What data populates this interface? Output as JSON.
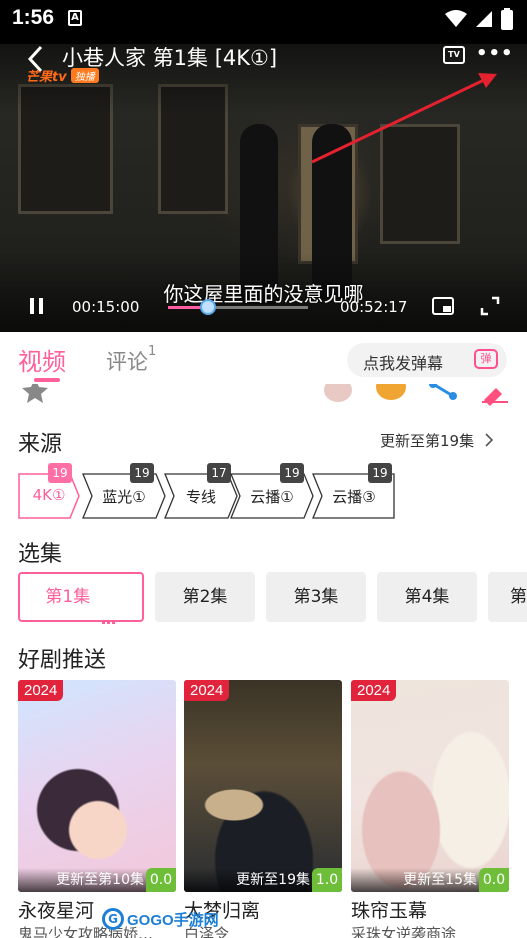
{
  "status_bar": {
    "time": "1:56",
    "notification_icon": "A"
  },
  "player": {
    "title": "小巷人家 第1集 [4K①]",
    "logo_text": "芒果tv",
    "logo_badge": "独播",
    "tv_label": "TV",
    "subtitle": "你这屋里面的没意见哪",
    "current_time": "00:15:00",
    "total_time": "00:52:17",
    "progress": 0.287
  },
  "tabs": {
    "video": "视频",
    "comment": "评论",
    "comment_count": "1",
    "danmu_placeholder": "点我发弹幕",
    "danmu_icon": "弹"
  },
  "source": {
    "title": "来源",
    "update": "更新至第19集",
    "items": [
      {
        "label": "4K①",
        "count": "19",
        "active": true
      },
      {
        "label": "蓝光①",
        "count": "19",
        "active": false
      },
      {
        "label": "专线",
        "count": "17",
        "active": false
      },
      {
        "label": "云播①",
        "count": "19",
        "active": false
      },
      {
        "label": "云播③",
        "count": "19",
        "active": false
      }
    ]
  },
  "episodes": {
    "title": "选集",
    "items": [
      "第1集",
      "第2集",
      "第3集",
      "第4集",
      "第"
    ]
  },
  "recommend": {
    "title": "好剧推送",
    "items": [
      {
        "year": "2024",
        "update": "更新至第10集",
        "score": "0.0",
        "title": "永夜星河",
        "desc": "鬼马少女攻略病娇…"
      },
      {
        "year": "2024",
        "update": "更新至19集",
        "score": "1.0",
        "title": "大梦归离",
        "desc": "白泽令"
      },
      {
        "year": "2024",
        "update": "更新至15集",
        "score": "0.0",
        "title": "珠帘玉幕",
        "desc": "采珠女逆袭商途"
      }
    ]
  },
  "watermark": {
    "logo": "G",
    "text": "GOGO手游网"
  },
  "colors": {
    "accent": "#ff5f9a",
    "badge_red": "#e1233c",
    "score_green": "#6ebe3a",
    "count_dark": "#444444"
  }
}
